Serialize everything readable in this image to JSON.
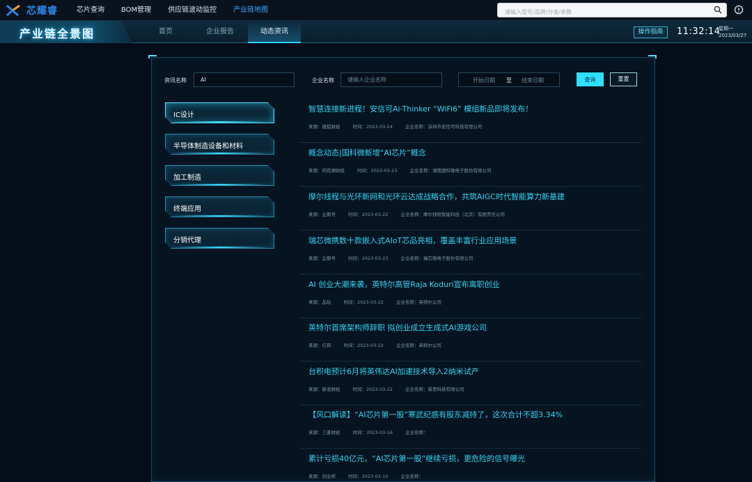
{
  "topnav": {
    "logo_text": "芯耀睿",
    "items": [
      "芯片查询",
      "BOM管理",
      "供应链波动监控",
      "产业链地图"
    ],
    "active_index": 3,
    "search_placeholder": "请输入型号/品牌/分类/参数"
  },
  "header": {
    "title": "产业链全景图",
    "tabs": [
      "首页",
      "企业报告",
      "动态资讯"
    ],
    "active_tab": 2,
    "guide_label": "操作指南",
    "time": "11:32:14",
    "weekday": "星期一",
    "date": "2023/03/27"
  },
  "filters": {
    "news_label": "资讯名称",
    "news_value": "AI",
    "company_label": "企业名称",
    "company_placeholder": "请输入企业名称",
    "start_placeholder": "开始日期",
    "range_sep": "至",
    "end_placeholder": "结束日期",
    "query_label": "查询",
    "reset_label": "重置"
  },
  "categories": [
    {
      "label": "IC设计",
      "active": true
    },
    {
      "label": "半导体制造设备和材料",
      "active": false
    },
    {
      "label": "加工制造",
      "active": false
    },
    {
      "label": "终端应用",
      "active": false
    },
    {
      "label": "分销代理",
      "active": false
    }
  ],
  "meta_labels": {
    "source": "来源：",
    "time": "时间：",
    "company": "企业名称："
  },
  "news": [
    {
      "title": "智慧连接新进程！安信可Ai-Thinker “WiFi6” 模组新品即将发布！",
      "source": "搜狐财经",
      "time": "2023-03-24",
      "company": "深圳市安信可科技有限公司"
    },
    {
      "title": "概念动态|国科微新增“AI芯片”概念",
      "source": "同花顺财经",
      "time": "2023-03-23",
      "company": "湖南国科微电子股份有限公司"
    },
    {
      "title": "摩尔线程与光环新网和光环云达成战略合作，共筑AIGC时代智能算力新基建",
      "source": "企鹅号",
      "time": "2023-03-22",
      "company": "摩尔线程智能科技（北京）有限责任公司"
    },
    {
      "title": "瑞芯微携数十款嵌入式AIoT芯品亮相，覆盖丰富行业应用场景",
      "source": "企鹅号",
      "time": "2023-03-23",
      "company": "瑞芯微电子股份有限公司"
    },
    {
      "title": "AI 创业大潮来袭，英特尔高管Raja Koduri宣布离职创业",
      "source": "品玩",
      "time": "2023-03-22",
      "company": "英特尔公司"
    },
    {
      "title": "英特尔首席架构师辞职 拟创业成立生成式AI游戏公司",
      "source": "亿邦",
      "time": "2023-03-22",
      "company": "英特尔公司"
    },
    {
      "title": "台积电预计6月将英伟达AI加速技术导入2纳米试产",
      "source": "新浪财经",
      "time": "2023-03-22",
      "company": "新思科技有限公司"
    },
    {
      "title": "【风口解读】“AI芯片第一股”寒武纪惑有股东减持了，这次合计不超3.34%",
      "source": "三菱财经",
      "time": "2023-03-16",
      "company": ""
    },
    {
      "title": "累计亏损40亿元，“AI芯片第一股”继续亏损，更危险的信号曝光",
      "source": "创业邦",
      "time": "2023-03-10",
      "company": ""
    }
  ]
}
